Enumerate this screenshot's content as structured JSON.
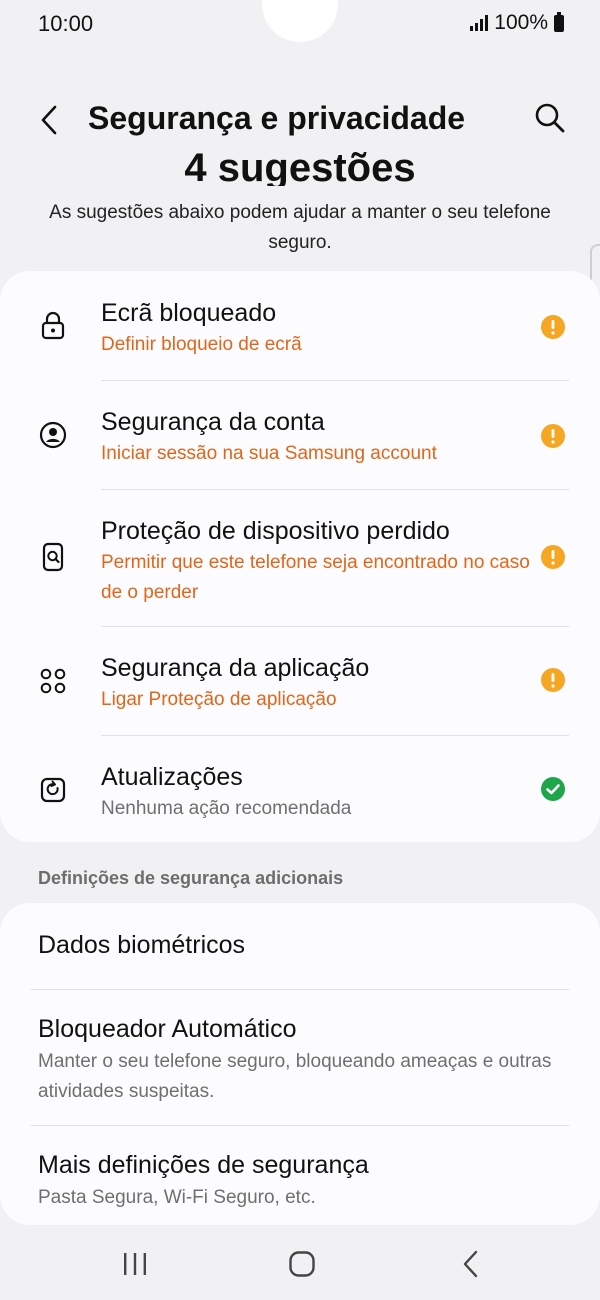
{
  "status_bar": {
    "time": "10:00",
    "battery_pct": "100%",
    "icons": [
      "signal-icon",
      "battery-icon"
    ]
  },
  "header": {
    "title": "Segurança e privacidade",
    "back_icon": "chevron-left-icon",
    "search_icon": "search-icon"
  },
  "suggestions": {
    "heading": "4 sugestões",
    "description": "As sugestões abaixo podem ajudar a manter o seu telefone seguro.",
    "items": [
      {
        "title": "Ecrã bloqueado",
        "subtitle": "Definir bloqueio de ecrã",
        "icon": "lock-icon",
        "status": "warning"
      },
      {
        "title": "Segurança da conta",
        "subtitle": "Iniciar sessão na sua Samsung account",
        "icon": "account-icon",
        "status": "warning"
      },
      {
        "title": "Proteção de dispositivo perdido",
        "subtitle": "Permitir que este telefone seja encontrado no caso de o perder",
        "icon": "find-device-icon",
        "status": "warning"
      },
      {
        "title": "Segurança da aplicação",
        "subtitle": "Ligar Proteção de aplicação",
        "icon": "apps-icon",
        "status": "warning"
      },
      {
        "title": "Atualizações",
        "subtitle": "Nenhuma ação recomendada",
        "icon": "update-icon",
        "status": "ok"
      }
    ]
  },
  "additional": {
    "section_label": "Definições de segurança adicionais",
    "items": [
      {
        "title": "Dados biométricos"
      },
      {
        "title": "Bloqueador Automático",
        "subtitle": "Manter o seu telefone seguro, bloqueando ameaças e outras atividades suspeitas."
      },
      {
        "title": "Mais definições de segurança",
        "subtitle": "Pasta Segura, Wi-Fi Seguro, etc."
      }
    ]
  },
  "nav_bar": {
    "icons": [
      "recents-icon",
      "home-icon",
      "back-icon"
    ]
  },
  "colors": {
    "warning": "#f5a623",
    "ok": "#1fa64a",
    "warning_text": "#e0661b"
  }
}
